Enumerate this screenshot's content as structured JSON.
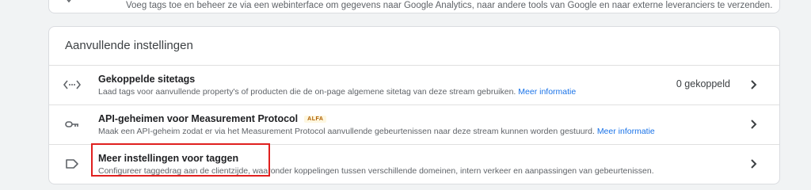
{
  "top": {
    "description": "Voeg tags toe en beheer ze via een webinterface om gegevens naar Google Analytics, naar andere tools van Google en naar externe leveranciers te verzenden."
  },
  "section": {
    "title": "Aanvullende instellingen",
    "rows": [
      {
        "icon": "code-brackets-icon",
        "title": "Gekoppelde sitetags",
        "description": "Laad tags voor aanvullende property's of producten die de on-page algemene sitetag van deze stream gebruiken.",
        "link": "Meer informatie",
        "count": "0 gekoppeld"
      },
      {
        "icon": "key-icon",
        "title": "API-geheimen voor Measurement Protocol",
        "badge": "ALFA",
        "description": "Maak een API-geheim zodat er via het Measurement Protocol aanvullende gebeurtenissen naar deze stream kunnen worden gestuurd.",
        "link": "Meer informatie"
      },
      {
        "icon": "label-icon",
        "title": "Meer instellingen voor taggen",
        "description": "Configureer taggedrag aan de clientzijde, waaronder koppelingen tussen verschillende domeinen, intern verkeer en aanpassingen van gebeurtenissen."
      }
    ]
  },
  "colors": {
    "link": "#1a73e8",
    "highlight_border": "#e0201f",
    "badge_bg": "#fef7e0",
    "badge_text": "#b06000"
  }
}
